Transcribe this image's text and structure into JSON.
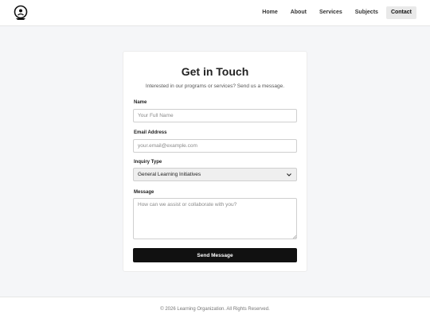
{
  "nav": {
    "items": [
      {
        "label": "Home",
        "active": false
      },
      {
        "label": "About",
        "active": false
      },
      {
        "label": "Services",
        "active": false
      },
      {
        "label": "Subjects",
        "active": false
      },
      {
        "label": "Contact",
        "active": true
      }
    ],
    "logo_icon": "globe-person-logo-icon"
  },
  "form": {
    "title": "Get in Touch",
    "subtitle": "Interested in our programs or services? Send us a message.",
    "name_label": "Name",
    "name_placeholder": "Your Full Name",
    "email_label": "Email Address",
    "email_placeholder": "your.email@example.com",
    "inquiry_label": "Inquiry Type",
    "inquiry_selected": "General Learning Initiatives",
    "message_label": "Message",
    "message_placeholder": "How can we assist or collaborate with you?",
    "submit_label": "Send Message"
  },
  "footer": {
    "text": "© 2026 Learning Organization. All Rights Reserved."
  },
  "colors": {
    "page_bg": "#f5f6f8",
    "button_bg": "#111111",
    "active_nav_bg": "#e9e9e9"
  }
}
